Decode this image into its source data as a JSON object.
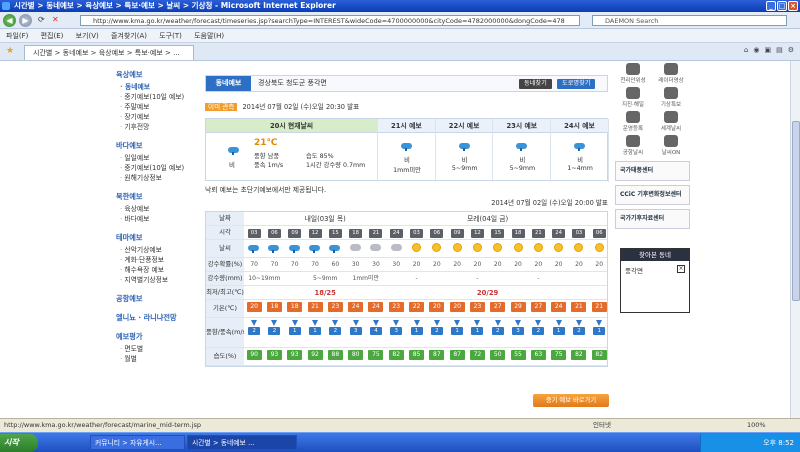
{
  "window": {
    "title": "시간별 > 동네예보 > 육상예보 > 특보·예보 > 날씨 > 기상청 - Microsoft Internet Explorer"
  },
  "address": {
    "url": "http://www.kma.go.kr/weather/forecast/timeseries.jsp?searchType=INTEREST&wideCode=4700000000&cityCode=4782000000&dongCode=478",
    "search_placeholder": "DAEMON Search"
  },
  "menu": [
    "파일(F)",
    "편집(E)",
    "보기(V)",
    "즐겨찾기(A)",
    "도구(T)",
    "도움말(H)"
  ],
  "tab": {
    "label": "시간별 > 동네예보 > 육상예보 > 특보·예보 > ..."
  },
  "sidebar": [
    {
      "heading": "육상예보",
      "items": [
        {
          "label": "동네예보",
          "selected": true
        },
        {
          "label": "중기예보(10일 예보)"
        },
        {
          "label": "주말예보"
        },
        {
          "label": "장기예보"
        },
        {
          "label": "기후전망"
        }
      ]
    },
    {
      "heading": "바다예보",
      "items": [
        {
          "label": "일일예보"
        },
        {
          "label": "중기예보(10일 예보)"
        },
        {
          "label": "원해기상정보"
        }
      ]
    },
    {
      "heading": "북한예보",
      "items": [
        {
          "label": "육상예보"
        },
        {
          "label": "바다예보"
        }
      ]
    },
    {
      "heading": "테마예보",
      "items": [
        {
          "label": "산악기상예보"
        },
        {
          "label": "계화·단풍정보"
        },
        {
          "label": "해수욕장 예보"
        },
        {
          "label": "지역별기상정보"
        }
      ]
    },
    {
      "heading": "공항예보",
      "items": []
    },
    {
      "heading": "엘니뇨 · 라니냐전망",
      "items": []
    },
    {
      "heading": "예보평가",
      "items": [
        {
          "label": "면도별"
        },
        {
          "label": "월별"
        }
      ]
    }
  ],
  "location": {
    "label": "동네예보",
    "text": "경상북도 청도군 풍각면",
    "btn_find": "동네찾기",
    "btn_map": "도로명찾기"
  },
  "issued": {
    "tag": "이미 관측",
    "text": "2014년 07월 02일 (수)오일 20:30 발표"
  },
  "now": {
    "header": "20시 현재날씨",
    "temp": "21℃",
    "weather": "비",
    "wind_label": "풍향 남풍",
    "wind_speed_label": "풍속 1m/s",
    "humidity_label": "습도 85%",
    "rain_label": "1시간 강수량 0.7mm"
  },
  "short_forecast": [
    {
      "header": "21시 예보",
      "weather": "비",
      "value": "1mm미만"
    },
    {
      "header": "22시 예보",
      "weather": "비",
      "value": "5~9mm"
    },
    {
      "header": "23시 예보",
      "weather": "비",
      "value": "5~9mm"
    },
    {
      "header": "24시 예보",
      "weather": "비",
      "value": "1~4mm"
    }
  ],
  "note": "낙뢰 예보는 초단기예보에서만 제공됩니다.",
  "issued2": "2014년 07월 02일 (수)오일 20:00 발표",
  "table": {
    "row_labels": {
      "date": "날짜",
      "time": "시각",
      "sky": "날씨",
      "pop": "강수확률(%)",
      "rain": "강수량(mm)",
      "minmax": "최저/최고(℃)",
      "temp": "기온(℃)",
      "wind": "풍향/풍속(m/s)",
      "hum": "습도(%)"
    },
    "days": [
      {
        "label": "내일(03일 목)",
        "minmax": "18/25"
      },
      {
        "label": "모레(04일 금)",
        "minmax": "20/29"
      }
    ],
    "hours": [
      "03",
      "06",
      "09",
      "12",
      "15",
      "18",
      "21",
      "24",
      "03",
      "06",
      "09",
      "12",
      "15",
      "18",
      "21",
      "24",
      "03",
      "06"
    ],
    "sky": [
      "rain",
      "rain",
      "rain",
      "rain",
      "rain",
      "cloud",
      "cloud",
      "cloud",
      "sun",
      "sun",
      "sun",
      "sun",
      "sun",
      "sun",
      "sun",
      "sun",
      "sun",
      "sun"
    ],
    "pop": [
      "70",
      "70",
      "70",
      "70",
      "60",
      "30",
      "30",
      "30",
      "20",
      "20",
      "20",
      "20",
      "20",
      "20",
      "20",
      "20",
      "20",
      "20"
    ],
    "rain": [
      "10~19mm",
      "",
      "",
      "5~9mm",
      "",
      "1mm미만",
      "",
      "",
      "-",
      "",
      "",
      "-",
      "",
      "",
      "-",
      "",
      "",
      ""
    ],
    "temp": [
      "20",
      "18",
      "18",
      "21",
      "23",
      "24",
      "24",
      "23",
      "22",
      "20",
      "20",
      "23",
      "27",
      "29",
      "27",
      "24",
      "21",
      "21"
    ],
    "wind": [
      "2",
      "2",
      "1",
      "1",
      "2",
      "3",
      "4",
      "3",
      "1",
      "2",
      "1",
      "1",
      "2",
      "3",
      "2",
      "1",
      "2",
      "1"
    ],
    "hum": [
      "90",
      "93",
      "93",
      "92",
      "88",
      "80",
      "75",
      "82",
      "85",
      "87",
      "87",
      "72",
      "50",
      "55",
      "63",
      "75",
      "82",
      "82"
    ]
  },
  "more_button": "중기 예보 바로가기",
  "right": {
    "icons": [
      "천리안위성",
      "레이더영상",
      "지진·해일",
      "기상특보",
      "운영등록",
      "세계날씨",
      "공항날씨",
      "날씨ON"
    ],
    "banners": [
      "국가태풍센터",
      "CCiC 기후변화정보센터",
      "국가기후자료센터"
    ],
    "fav_title": "찾아본 동네",
    "fav_item": "풍각면"
  },
  "status": {
    "url": "http://www.kma.go.kr/weather/forecast/marine_mid-term.jsp",
    "zone": "인터넷",
    "zoom": "100%"
  },
  "taskbar": {
    "start": "시작",
    "tasks": [
      "커뮤니티 > 자유게시...",
      "시간별 > 동네예보 ..."
    ],
    "clock": "오후 8:52"
  }
}
